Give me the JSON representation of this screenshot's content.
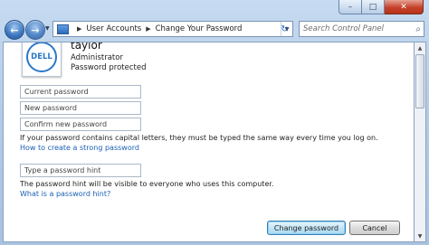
{
  "window": {
    "minimize_icon": "minimize-icon",
    "maximize_icon": "maximize-icon",
    "close_icon": "close-icon",
    "close_color": "#c4412a"
  },
  "nav": {
    "back_icon": "back-arrow-icon",
    "forward_icon": "forward-arrow-icon",
    "breadcrumbs": [
      "User Accounts",
      "Change Your Password"
    ],
    "refresh_icon": "refresh-icon",
    "search_placeholder": "Search Control Panel"
  },
  "user": {
    "name": "taylor",
    "role": "Administrator",
    "status": "Password protected",
    "avatar_text": "DELL"
  },
  "form": {
    "current_password_placeholder": "Current password",
    "new_password_placeholder": "New password",
    "confirm_password_placeholder": "Confirm new password",
    "caps_note": "If your password contains capital letters, they must be typed the same way every time you log on.",
    "strong_password_link": "How to create a strong password",
    "hint_placeholder": "Type a password hint",
    "hint_note": "The password hint will be visible to everyone who uses this computer.",
    "hint_link": "What is a password hint?",
    "change_button": "Change password",
    "cancel_button": "Cancel"
  },
  "colors": {
    "link": "#1a5fb4",
    "accent": "#2b77c8"
  }
}
